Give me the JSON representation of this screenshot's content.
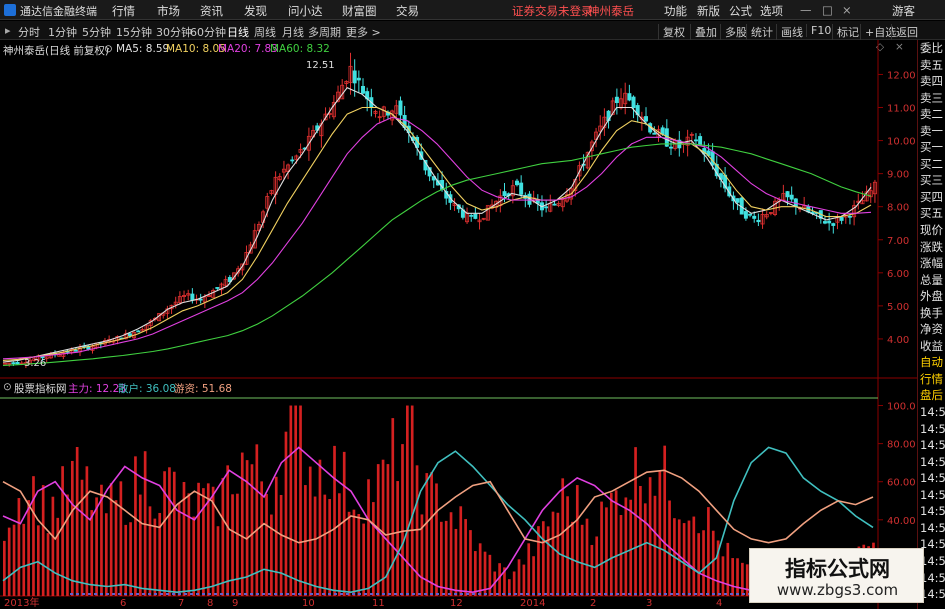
{
  "app": {
    "title": "通达信金融终端"
  },
  "menu": {
    "items": [
      "行情",
      "市场",
      "资讯",
      "发现",
      "问小达",
      "财富圈",
      "交易"
    ],
    "status": "证券交易未登录",
    "stock": "神州泰岳",
    "right": [
      "功能",
      "新版",
      "公式",
      "选项"
    ],
    "user": "游客"
  },
  "toolbar": {
    "periods": [
      "分时",
      "1分钟",
      "5分钟",
      "15分钟",
      "30分钟",
      "60分钟",
      "日线",
      "周线",
      "月线",
      "多周期",
      "更多 >"
    ],
    "active": "日线",
    "buttons": [
      "复权",
      "叠加",
      "多股",
      "统计",
      "画线",
      "F10",
      "标记",
      "+自选",
      "返回"
    ]
  },
  "price_legend": {
    "title": "神州泰岳",
    "subtitle": "(日线 前复权)",
    "ma": [
      {
        "label": "MA5: 8.59",
        "color": "#e0e0e0"
      },
      {
        "label": "MA10: 8.05",
        "color": "#f0d060"
      },
      {
        "label": "MA20: 7.83",
        "color": "#e040e0"
      },
      {
        "label": "MA60: 8.32",
        "color": "#40d040"
      }
    ]
  },
  "price_axis": [
    "12.00",
    "11.00",
    "10.00",
    "9.00",
    "8.00",
    "7.00",
    "6.00",
    "5.00",
    "4.00"
  ],
  "annotations": {
    "high": "12.51",
    "low": "3.26"
  },
  "indicator_legend": {
    "title": "股票指标网",
    "items": [
      {
        "label": "主力: 12.23",
        "color": "#e040e0"
      },
      {
        "label": "散户: 36.08",
        "color": "#40c0c0"
      },
      {
        "label": "游资: 51.68",
        "color": "#f0a080"
      }
    ]
  },
  "indicator_axis": [
    "100.0",
    "80.00",
    "60.00",
    "40.00"
  ],
  "date_axis": [
    "2013年",
    "6",
    "7",
    "8",
    "9",
    "10",
    "11",
    "12",
    "2014",
    "2",
    "3",
    "4"
  ],
  "side_panel": {
    "items": [
      "委比",
      "卖五",
      "卖四",
      "卖三",
      "卖二",
      "卖一",
      "买一",
      "买二",
      "买三",
      "买四",
      "买五",
      "现价",
      "涨跌",
      "涨幅",
      "总量",
      "外盘",
      "换手",
      "净资",
      "收益",
      "自动",
      "行情",
      "盘后",
      "14:5",
      "14:5",
      "14:5",
      "14:5",
      "14:5",
      "14:5",
      "14:5",
      "14:5",
      "14:5",
      "14:5",
      "14:5",
      "14:5"
    ]
  },
  "watermark": {
    "title": "指标公式网",
    "url": "www.zbgs3.com"
  },
  "colors": {
    "up": "#e03030",
    "down": "#40e0e0",
    "ma5": "#e0e0e0",
    "ma10": "#f0d060",
    "ma20": "#e040e0",
    "ma60": "#40d040",
    "axis_red": "#8b0000"
  },
  "chart_data": [
    {
      "type": "candlestick",
      "title": "神州泰岳 (日线 前复权)",
      "ylim": [
        3.0,
        12.8
      ],
      "y_scale": "linear",
      "x_labels": [
        "2013年",
        "6",
        "7",
        "8",
        "9",
        "10",
        "11",
        "12",
        "2014",
        "2",
        "3",
        "4"
      ],
      "close_path": [
        3.26,
        3.3,
        3.4,
        3.5,
        3.6,
        3.7,
        3.8,
        3.95,
        4.1,
        4.3,
        4.6,
        5.0,
        5.3,
        5.2,
        5.5,
        5.8,
        6.5,
        7.6,
        8.8,
        9.3,
        9.8,
        10.5,
        11.2,
        12.2,
        11.4,
        10.8,
        11.0,
        10.2,
        9.2,
        8.5,
        8.0,
        7.6,
        7.8,
        8.3,
        8.6,
        8.2,
        7.9,
        8.2,
        8.8,
        9.8,
        10.6,
        11.4,
        11.1,
        10.4,
        10.0,
        9.8,
        10.1,
        9.4,
        8.6,
        7.9,
        7.6,
        7.9,
        8.3,
        8.0,
        7.7,
        7.5,
        7.7,
        8.1,
        8.6
      ],
      "series": [
        {
          "name": "MA5",
          "values": [
            3.3,
            3.35,
            3.45,
            3.55,
            3.65,
            3.75,
            3.85,
            3.95,
            4.1,
            4.3,
            4.55,
            4.9,
            5.1,
            5.2,
            5.4,
            5.6,
            6.2,
            7.1,
            8.2,
            9.0,
            9.6,
            10.3,
            11.0,
            11.6,
            11.4,
            11.0,
            10.8,
            10.3,
            9.5,
            8.8,
            8.2,
            7.8,
            7.8,
            8.1,
            8.4,
            8.3,
            8.0,
            8.2,
            8.6,
            9.5,
            10.3,
            11.0,
            11.0,
            10.5,
            10.1,
            9.9,
            10.0,
            9.5,
            8.8,
            8.1,
            7.8,
            7.9,
            8.2,
            8.0,
            7.8,
            7.6,
            7.7,
            8.0,
            8.59
          ]
        },
        {
          "name": "MA10",
          "values": [
            3.35,
            3.38,
            3.45,
            3.52,
            3.6,
            3.7,
            3.8,
            3.9,
            4.0,
            4.15,
            4.35,
            4.6,
            4.85,
            5.0,
            5.2,
            5.4,
            5.8,
            6.5,
            7.3,
            8.1,
            8.8,
            9.5,
            10.2,
            10.8,
            11.0,
            11.0,
            10.8,
            10.4,
            9.8,
            9.2,
            8.6,
            8.1,
            7.9,
            8.0,
            8.2,
            8.3,
            8.2,
            8.2,
            8.4,
            9.0,
            9.7,
            10.3,
            10.6,
            10.5,
            10.2,
            10.0,
            9.9,
            9.6,
            9.1,
            8.5,
            8.0,
            7.9,
            8.0,
            8.0,
            7.9,
            7.7,
            7.7,
            7.8,
            8.05
          ]
        },
        {
          "name": "MA20",
          "values": [
            3.4,
            3.42,
            3.45,
            3.5,
            3.55,
            3.6,
            3.7,
            3.8,
            3.9,
            4.0,
            4.15,
            4.35,
            4.55,
            4.75,
            4.95,
            5.15,
            5.4,
            5.8,
            6.3,
            6.9,
            7.5,
            8.2,
            8.9,
            9.6,
            10.1,
            10.5,
            10.7,
            10.6,
            10.3,
            9.9,
            9.4,
            8.9,
            8.5,
            8.3,
            8.2,
            8.2,
            8.2,
            8.2,
            8.3,
            8.6,
            9.0,
            9.5,
            9.9,
            10.1,
            10.1,
            10.0,
            9.9,
            9.8,
            9.5,
            9.1,
            8.7,
            8.4,
            8.2,
            8.1,
            8.0,
            7.9,
            7.8,
            7.8,
            7.83
          ]
        },
        {
          "name": "MA60",
          "values": [
            3.2,
            3.22,
            3.25,
            3.28,
            3.32,
            3.36,
            3.4,
            3.45,
            3.5,
            3.56,
            3.62,
            3.7,
            3.8,
            3.9,
            4.0,
            4.1,
            4.25,
            4.45,
            4.7,
            5.0,
            5.3,
            5.65,
            6.0,
            6.4,
            6.8,
            7.2,
            7.6,
            7.9,
            8.2,
            8.45,
            8.65,
            8.8,
            8.9,
            9.0,
            9.1,
            9.2,
            9.3,
            9.35,
            9.4,
            9.5,
            9.6,
            9.7,
            9.8,
            9.85,
            9.9,
            9.9,
            9.9,
            9.85,
            9.8,
            9.7,
            9.6,
            9.45,
            9.3,
            9.15,
            9.0,
            8.8,
            8.6,
            8.45,
            8.32
          ]
        }
      ]
    },
    {
      "type": "bar+line",
      "title": "股票指标网",
      "ylim": [
        0,
        105
      ],
      "y_ticks": [
        100,
        80,
        60,
        40
      ],
      "volume_bars": [
        42,
        55,
        62,
        48,
        55,
        70,
        60,
        48,
        52,
        58,
        72,
        58,
        65,
        50,
        55,
        48,
        66,
        78,
        70,
        60,
        88,
        98,
        70,
        76,
        68,
        55,
        60,
        65,
        85,
        90,
        58,
        55,
        46,
        38,
        25,
        18,
        12,
        20,
        30,
        45,
        58,
        50,
        40,
        48,
        62,
        70,
        75,
        68,
        55,
        52,
        45,
        30,
        20,
        15,
        10,
        5,
        3,
        2,
        2,
        3,
        5,
        25,
        30
      ],
      "series": [
        {
          "name": "主力",
          "values": [
            42,
            38,
            55,
            60,
            48,
            40,
            56,
            68,
            62,
            58,
            45,
            40,
            52,
            66,
            60,
            52,
            70,
            78,
            70,
            62,
            55,
            40,
            30,
            20,
            10,
            5,
            3,
            2,
            4,
            15,
            30,
            45,
            55,
            62,
            58,
            50,
            45,
            38,
            28,
            20,
            12,
            8,
            5,
            3,
            2,
            2,
            2,
            2,
            3,
            8,
            12
          ]
        },
        {
          "name": "散户",
          "values": [
            8,
            15,
            18,
            12,
            8,
            6,
            5,
            6,
            4,
            3,
            2,
            3,
            5,
            8,
            10,
            14,
            12,
            8,
            5,
            3,
            2,
            4,
            10,
            28,
            55,
            70,
            76,
            68,
            58,
            48,
            40,
            30,
            22,
            18,
            15,
            20,
            24,
            28,
            24,
            18,
            12,
            20,
            50,
            70,
            78,
            75,
            62,
            55,
            50,
            42,
            36
          ]
        },
        {
          "name": "游资",
          "values": [
            60,
            55,
            40,
            30,
            45,
            55,
            52,
            45,
            38,
            36,
            48,
            55,
            50,
            35,
            30,
            38,
            32,
            28,
            30,
            35,
            42,
            40,
            32,
            34,
            35,
            45,
            52,
            58,
            60,
            45,
            30,
            28,
            32,
            40,
            52,
            55,
            60,
            65,
            66,
            62,
            55,
            45,
            35,
            30,
            28,
            30,
            38,
            45,
            50,
            48,
            52
          ]
        }
      ]
    }
  ]
}
